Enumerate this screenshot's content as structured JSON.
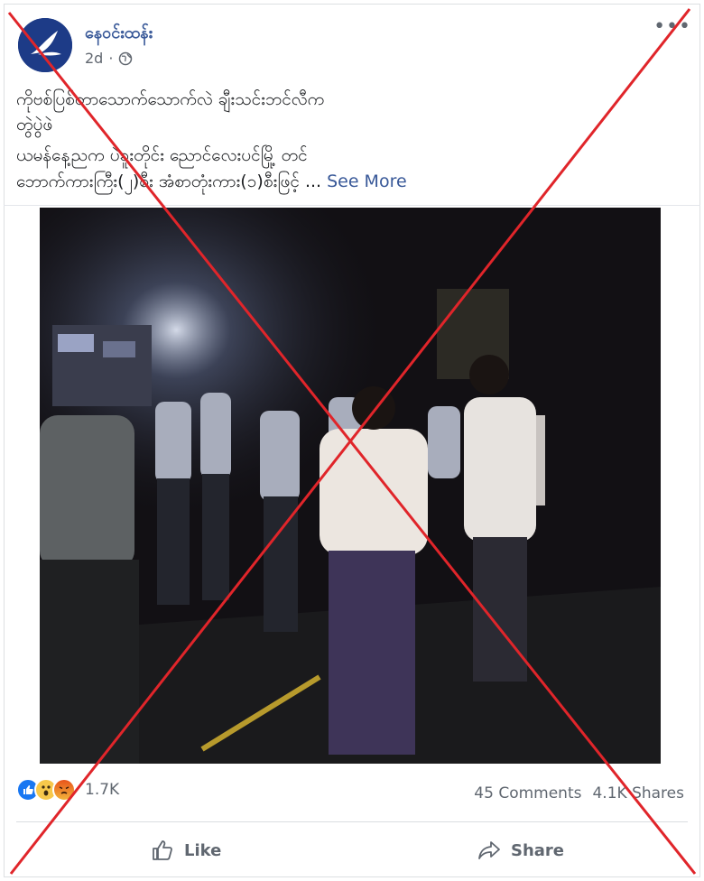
{
  "post": {
    "page_name": "နေဝင်းထန်း",
    "time": "2d",
    "privacy_icon": "globe-icon",
    "more_icon": "ellipsis-icon",
    "text_lines": [
      "ကိုဗစ်ပြစ်တာသောက်သောက်လဲ ချီးသင်းဘင်လီက",
      "တွဲပွဲဖဲ",
      "ယမန်နေ့ညက ပဲခူးတိုင်း ညောင်လေးပင်မြို့ တင်",
      "ဘောက်ကားကြီး(၂)စီး အံစာတုံးကား(၁)စီးဖြင့် ..."
    ],
    "see_more": "See More",
    "photo_alt": "Night street scene with a group of men in white shirts and longyi"
  },
  "reactions": {
    "icons": [
      "like-reaction-icon",
      "wow-reaction-icon",
      "angry-reaction-icon"
    ],
    "count": "1.7K"
  },
  "stats": {
    "comments": "45 Comments",
    "shares": "4.1K Shares"
  },
  "actions": {
    "like_label": "Like",
    "share_label": "Share"
  },
  "colors": {
    "link": "#385898",
    "cross": "#e0252a",
    "like_blue": "#1877f2"
  }
}
